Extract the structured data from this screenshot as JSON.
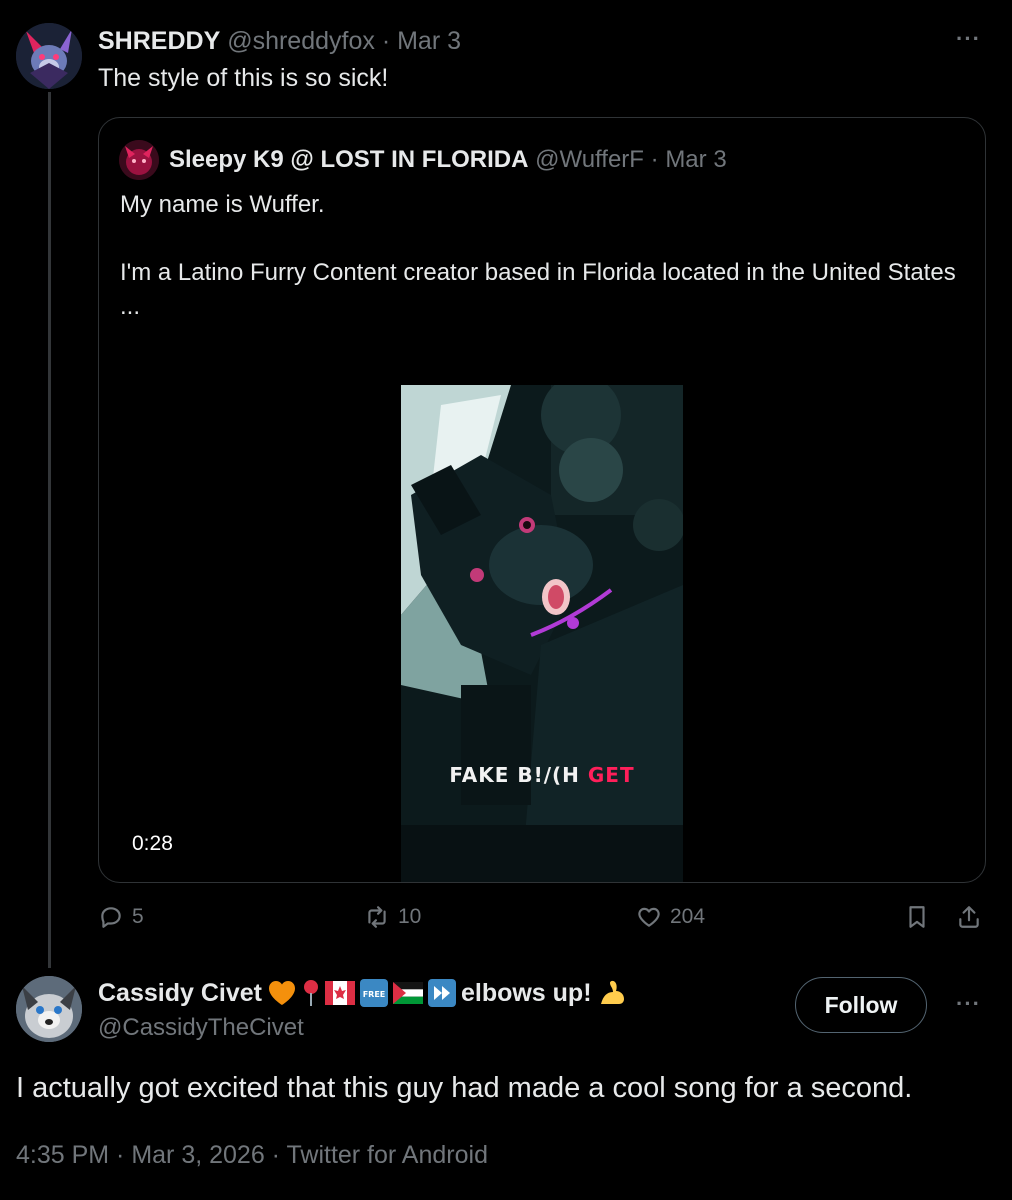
{
  "tweet1": {
    "display_name": "SHREDDY",
    "handle": "@shreddyfox",
    "separator": "·",
    "date": "Mar 3",
    "more_label": "···",
    "text": "The style of this is so sick!",
    "quoted": {
      "display_name": "Sleepy K9 @ LOST IN FLORIDA",
      "handle": "@WufferF",
      "separator": "·",
      "date": "Mar 3",
      "body_lines": [
        "My name is Wuffer.",
        "",
        "I'm a Latino Furry Content creator based in Florida located in the United States",
        "..."
      ],
      "video": {
        "caption_main": "FAKE B!/(H",
        "caption_highlight": "GET",
        "duration": "0:28"
      }
    },
    "actions": {
      "reply_count": "5",
      "retweet_count": "10",
      "like_count": "204"
    }
  },
  "tweet2": {
    "display_name": "Cassidy Civet",
    "name_suffix": "elbows up!",
    "emoji_icons": [
      "orange-heart-icon",
      "round-pushpin-icon",
      "canada-flag-icon",
      "free-button-icon",
      "palestine-flag-icon",
      "fast-forward-icon",
      "flexed-biceps-icon"
    ],
    "handle": "@CassidyTheCivet",
    "follow_label": "Follow",
    "more_label": "···",
    "text": "I actually got excited that this guy had made a cool song for a second.",
    "timestamp": "4:35 PM · Mar 3, 2026 · Twitter for Android"
  },
  "colors": {
    "background": "#000000",
    "primary_text": "#e7e9ea",
    "secondary_text": "#71767b",
    "border": "#2f3336",
    "caption_highlight": "#ff1f5a"
  }
}
